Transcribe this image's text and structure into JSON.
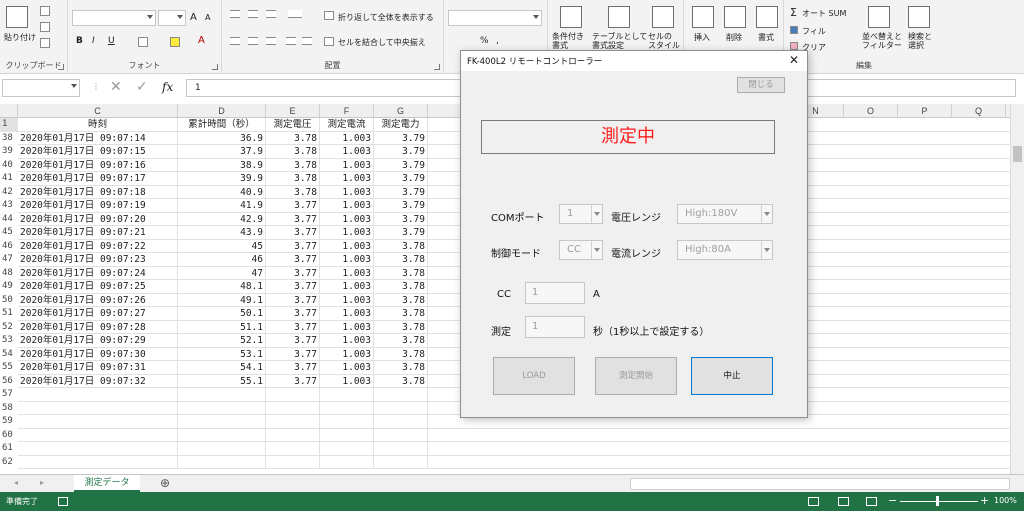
{
  "ribbon": {
    "clipboard": {
      "paste": "貼り付け",
      "label": "クリップボード"
    },
    "font": {
      "label": "フォント",
      "bold": "B",
      "italic": "I",
      "underline": "U",
      "grow": "A",
      "shrink": "A",
      "color": "A"
    },
    "alignment": {
      "wrap": "折り返して全体を表示する",
      "merge": "セルを結合して中央揃え",
      "label": "配置"
    },
    "number": {
      "percent": "%",
      "comma": ","
    },
    "styles": {
      "conditional": "条件付き\n書式",
      "table": "テーブルとして\n書式設定",
      "cellstyle": "セルの\nスタイル"
    },
    "cells": {
      "insert": "挿入",
      "delete": "削除",
      "format": "書式"
    },
    "editing": {
      "autosum": "オート SUM",
      "fill": "フィル",
      "clear": "クリア",
      "sort": "並べ替えと\nフィルター",
      "find": "検索と\n選択",
      "label": "編集"
    }
  },
  "formula_bar": {
    "fx": "fx",
    "value": "1"
  },
  "columns": [
    "C",
    "D",
    "E",
    "F",
    "G",
    "",
    "",
    "",
    "",
    "",
    "",
    "N",
    "O",
    "P",
    "Q"
  ],
  "header_row": {
    "num": "1",
    "c": "時刻",
    "d": "累計時間（秒）",
    "e": "測定電圧",
    "f": "測定電流",
    "g": "測定電力"
  },
  "rows": [
    {
      "num": "38",
      "c": "2020年01月17日  09:07:14",
      "d": "36.9",
      "e": "3.78",
      "f": "1.003",
      "g": "3.79"
    },
    {
      "num": "39",
      "c": "2020年01月17日  09:07:15",
      "d": "37.9",
      "e": "3.78",
      "f": "1.003",
      "g": "3.79"
    },
    {
      "num": "40",
      "c": "2020年01月17日  09:07:16",
      "d": "38.9",
      "e": "3.78",
      "f": "1.003",
      "g": "3.79"
    },
    {
      "num": "41",
      "c": "2020年01月17日  09:07:17",
      "d": "39.9",
      "e": "3.78",
      "f": "1.003",
      "g": "3.79"
    },
    {
      "num": "42",
      "c": "2020年01月17日  09:07:18",
      "d": "40.9",
      "e": "3.78",
      "f": "1.003",
      "g": "3.79"
    },
    {
      "num": "43",
      "c": "2020年01月17日  09:07:19",
      "d": "41.9",
      "e": "3.77",
      "f": "1.003",
      "g": "3.79"
    },
    {
      "num": "44",
      "c": "2020年01月17日  09:07:20",
      "d": "42.9",
      "e": "3.77",
      "f": "1.003",
      "g": "3.79"
    },
    {
      "num": "45",
      "c": "2020年01月17日  09:07:21",
      "d": "43.9",
      "e": "3.77",
      "f": "1.003",
      "g": "3.79"
    },
    {
      "num": "46",
      "c": "2020年01月17日  09:07:22",
      "d": "45",
      "e": "3.77",
      "f": "1.003",
      "g": "3.78"
    },
    {
      "num": "47",
      "c": "2020年01月17日  09:07:23",
      "d": "46",
      "e": "3.77",
      "f": "1.003",
      "g": "3.78"
    },
    {
      "num": "48",
      "c": "2020年01月17日  09:07:24",
      "d": "47",
      "e": "3.77",
      "f": "1.003",
      "g": "3.78"
    },
    {
      "num": "49",
      "c": "2020年01月17日  09:07:25",
      "d": "48.1",
      "e": "3.77",
      "f": "1.003",
      "g": "3.78"
    },
    {
      "num": "50",
      "c": "2020年01月17日  09:07:26",
      "d": "49.1",
      "e": "3.77",
      "f": "1.003",
      "g": "3.78"
    },
    {
      "num": "51",
      "c": "2020年01月17日  09:07:27",
      "d": "50.1",
      "e": "3.77",
      "f": "1.003",
      "g": "3.78"
    },
    {
      "num": "52",
      "c": "2020年01月17日  09:07:28",
      "d": "51.1",
      "e": "3.77",
      "f": "1.003",
      "g": "3.78"
    },
    {
      "num": "53",
      "c": "2020年01月17日  09:07:29",
      "d": "52.1",
      "e": "3.77",
      "f": "1.003",
      "g": "3.78"
    },
    {
      "num": "54",
      "c": "2020年01月17日  09:07:30",
      "d": "53.1",
      "e": "3.77",
      "f": "1.003",
      "g": "3.78"
    },
    {
      "num": "55",
      "c": "2020年01月17日  09:07:31",
      "d": "54.1",
      "e": "3.77",
      "f": "1.003",
      "g": "3.78"
    },
    {
      "num": "56",
      "c": "2020年01月17日  09:07:32",
      "d": "55.1",
      "e": "3.77",
      "f": "1.003",
      "g": "3.78"
    },
    {
      "num": "57",
      "c": "",
      "d": "",
      "e": "",
      "f": "",
      "g": ""
    },
    {
      "num": "58",
      "c": "",
      "d": "",
      "e": "",
      "f": "",
      "g": ""
    },
    {
      "num": "59",
      "c": "",
      "d": "",
      "e": "",
      "f": "",
      "g": ""
    },
    {
      "num": "60",
      "c": "",
      "d": "",
      "e": "",
      "f": "",
      "g": ""
    },
    {
      "num": "61",
      "c": "",
      "d": "",
      "e": "",
      "f": "",
      "g": ""
    },
    {
      "num": "62",
      "c": "",
      "d": "",
      "e": "",
      "f": "",
      "g": ""
    }
  ],
  "sheet_tab": "測定データ",
  "status": {
    "ready": "準備完了",
    "zoom": "100%"
  },
  "dialog": {
    "title": "FK-400L2 リモートコントローラー",
    "close_label": "閉じる",
    "status_text": "測定中",
    "com_label": "COMポート",
    "com_value": "1",
    "voltage_range_label": "電圧レンジ",
    "voltage_range_value": "High:180V",
    "control_mode_label": "制御モード",
    "control_mode_value": "CC",
    "current_range_label": "電流レンジ",
    "current_range_value": "High:80A",
    "cc_label": "CC",
    "cc_value": "1",
    "cc_unit": "A",
    "measure_label": "測定",
    "measure_value": "1",
    "measure_unit": "秒（1秒以上で設定する）",
    "load_button": "LOAD",
    "start_button": "測定開始",
    "stop_button": "中止"
  },
  "colors": {
    "excel_green": "#217346",
    "status_red": "#ff1a1a",
    "dialog_focus": "#0078d7"
  }
}
